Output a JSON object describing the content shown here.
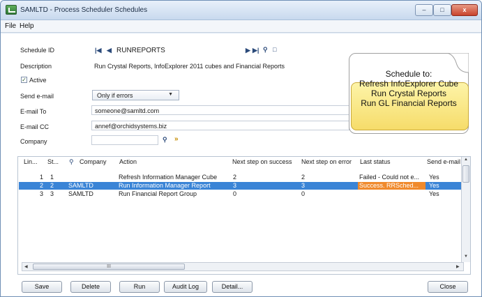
{
  "window": {
    "title": "SAMLTD - Process Scheduler Schedules",
    "minimize": "–",
    "maximize": "□",
    "close": "x"
  },
  "menu": [
    "File",
    "Help"
  ],
  "form": {
    "schedule_id_label": "Schedule ID",
    "schedule_id_value": "RUNREPORTS",
    "description_label": "Description",
    "description_value": "Run Crystal Reports, InfoExplorer 2011 cubes and Financial Reports",
    "active_label": "Active",
    "active_checked": true,
    "send_email_label": "Send e-mail",
    "send_email_value": "Only if errors",
    "email_to_label": "E-mail To",
    "email_to_value": "someone@samltd.com",
    "email_cc_label": "E-mail CC",
    "email_cc_value": "annef@orchidsystems.biz",
    "company_label": "Company",
    "company_value": ""
  },
  "callout": {
    "line1": "Schedule to:",
    "line2": "Refresh InfoExplorer Cube",
    "line3": "Run Crystal Reports",
    "line4": "Run GL Financial Reports"
  },
  "grid": {
    "headers": [
      "Lin...",
      "St...",
      "Company",
      "Action",
      "Next step on success",
      "Next step on error",
      "Last status",
      "Send e-mail"
    ],
    "rows": [
      {
        "line": "1",
        "step": "1",
        "company": "",
        "action": "Refresh Information Manager Cube",
        "next_success": "2",
        "next_error": "2",
        "last_status": "Failed - Could not e...",
        "send_email": "Yes"
      },
      {
        "line": "2",
        "step": "2",
        "company": "SAMLTD",
        "action": "Run Information Manager Report",
        "next_success": "3",
        "next_error": "3",
        "last_status": "Success. RRSched...",
        "send_email": "Yes"
      },
      {
        "line": "3",
        "step": "3",
        "company": "SAMLTD",
        "action": "Run Financial Report Group",
        "next_success": "0",
        "next_error": "0",
        "last_status": "",
        "send_email": "Yes"
      }
    ],
    "hscroll_label": "III"
  },
  "buttons": {
    "save": "Save",
    "delete": "Delete",
    "run": "Run",
    "audit_log": "Audit Log",
    "detail": "Detail...",
    "close": "Close"
  }
}
